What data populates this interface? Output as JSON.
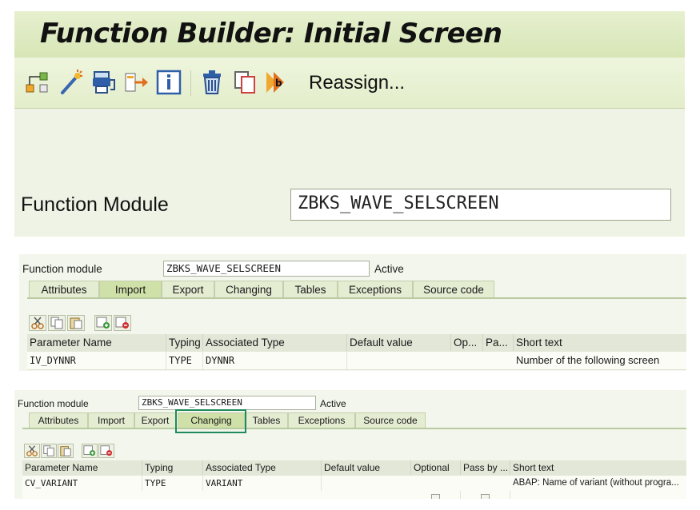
{
  "initial_screen": {
    "title": "Function Builder: Initial Screen",
    "toolbar": {
      "icons": [
        "hierarchy-icon",
        "magic-wand-icon",
        "print-clamp-icon",
        "reassign-arrow-icon",
        "info-icon",
        "trash-icon",
        "copy-icon",
        "rename-icon"
      ],
      "reassign_label": "Reassign..."
    },
    "function_module_label": "Function Module",
    "function_module_value": "ZBKS_WAVE_SELSCREEN"
  },
  "import_view": {
    "function_module_label": "Function module",
    "function_module_value": "ZBKS_WAVE_SELSCREEN",
    "status": "Active",
    "tabs": [
      "Attributes",
      "Import",
      "Export",
      "Changing",
      "Tables",
      "Exceptions",
      "Source code"
    ],
    "active_tab": "Import",
    "columns": [
      "Parameter Name",
      "Typing",
      "Associated Type",
      "Default value",
      "Op...",
      "Pa...",
      "Short text"
    ],
    "rows": [
      {
        "parameter": "IV_DYNNR",
        "typing": "TYPE",
        "associated_type": "DYNNR",
        "default_value": "",
        "optional": false,
        "pass_by_value": false,
        "short_text": "Number of the following screen"
      }
    ]
  },
  "changing_view": {
    "function_module_label": "Function module",
    "function_module_value": "ZBKS_WAVE_SELSCREEN",
    "status": "Active",
    "tabs": [
      "Attributes",
      "Import",
      "Export",
      "Changing",
      "Tables",
      "Exceptions",
      "Source code"
    ],
    "active_tab": "Changing",
    "columns": [
      "Parameter Name",
      "Typing",
      "Associated Type",
      "Default value",
      "Optional",
      "Pass by ...",
      "Short text"
    ],
    "rows": [
      {
        "parameter": "CV_VARIANT",
        "typing": "TYPE",
        "associated_type": "VARIANT",
        "default_value": "",
        "optional": false,
        "pass_by_value": false,
        "short_text": "ABAP: Name of variant (without progra..."
      }
    ]
  },
  "colors": {
    "highlight": "#1f8a5b",
    "active_tab": "#cfe0a8",
    "titlebar": "#d7e6b6"
  }
}
